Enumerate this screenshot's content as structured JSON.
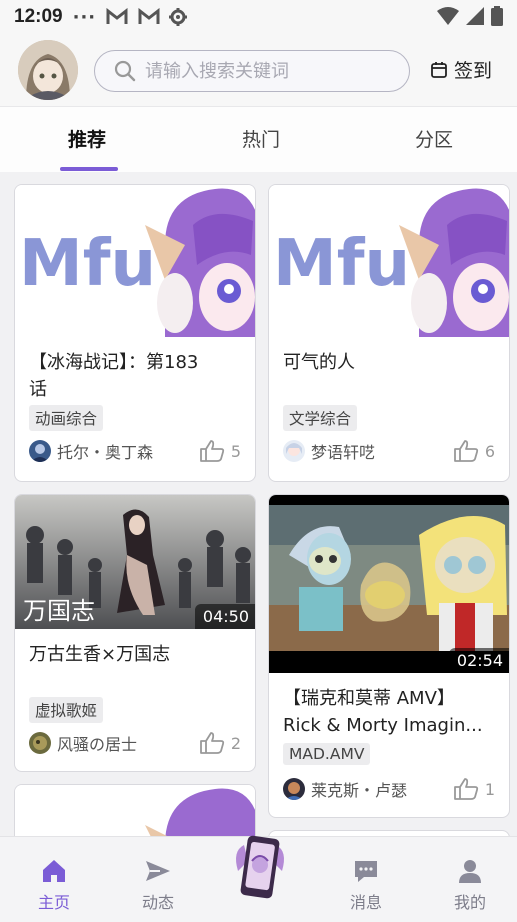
{
  "status_bar": {
    "time": "12:09",
    "dots": "···"
  },
  "header": {
    "search_placeholder": "请输入搜索关键词",
    "signin_label": "签到"
  },
  "tabs": [
    {
      "label": "推荐",
      "active": true
    },
    {
      "label": "热门",
      "active": false
    },
    {
      "label": "分区",
      "active": false
    }
  ],
  "feed": {
    "cards": [
      {
        "title_line1": "【冰海战记】：第183",
        "title_line2": "话",
        "tag": "动画综合",
        "author": "托尔・奥丁森",
        "likes": "5",
        "thumbnail": "mfun-placeholder"
      },
      {
        "title_line1": "可气的人",
        "title_line2": "",
        "tag": "文学综合",
        "author": "梦语轩呓",
        "likes": "6",
        "thumbnail": "mfun-placeholder"
      },
      {
        "title_line1": "万古生香×万国志",
        "title_line2": "",
        "tag": "虚拟歌姬",
        "author": "风骚の居士",
        "likes": "2",
        "duration": "04:50",
        "thumbnail_text": "万国志"
      },
      {
        "title_line1": "【瑞克和莫蒂 AMV】",
        "title_line2": "Rick & Morty Imagin...",
        "tag": "MAD.AMV",
        "author": "莱克斯・卢瑟",
        "likes": "1",
        "duration": "02:54"
      }
    ],
    "partial_card_logo": "Mfu"
  },
  "thumbnail_logo_text": "Mfu",
  "bottom_nav": [
    {
      "label": "主页",
      "icon": "home-icon",
      "active": true
    },
    {
      "label": "动态",
      "icon": "send-icon",
      "active": false
    },
    {
      "label": "消息",
      "icon": "message-icon",
      "active": false
    },
    {
      "label": "我的",
      "icon": "person-icon",
      "active": false
    }
  ],
  "colors": {
    "accent": "#7b5cd6",
    "mascot_purple": "#9a6ad0",
    "logo_blue": "#8a96d6"
  }
}
